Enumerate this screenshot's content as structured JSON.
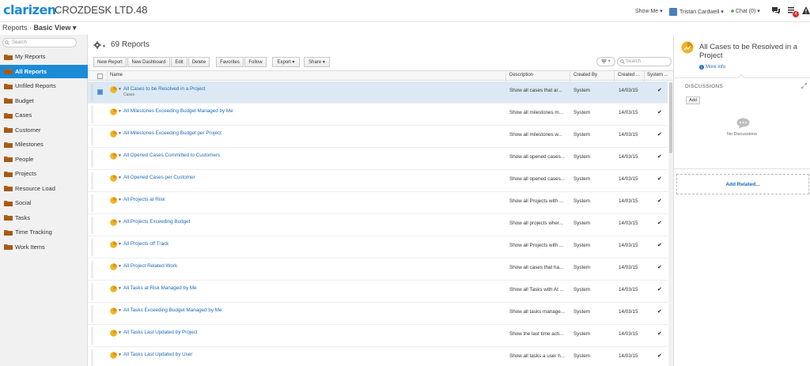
{
  "header": {
    "logo": "clarizen",
    "company": "CROZDESK LTD.48",
    "show_me": "Show Me ▾",
    "user_name": "Tristan Cardwell ▾",
    "chat": "Chat (0) ▾",
    "notification_count": "4"
  },
  "breadcrumb": {
    "section": "Reports · ",
    "view": "Basic View ▾"
  },
  "sidebar": {
    "search_placeholder": "Search",
    "items": [
      {
        "label": "My Reports"
      },
      {
        "label": "All Reports"
      },
      {
        "label": "Unfiled Reports"
      },
      {
        "label": "Budget"
      },
      {
        "label": "Cases"
      },
      {
        "label": "Customer"
      },
      {
        "label": "Milestones"
      },
      {
        "label": "People"
      },
      {
        "label": "Projects"
      },
      {
        "label": "Resource Load"
      },
      {
        "label": "Social"
      },
      {
        "label": "Tasks"
      },
      {
        "label": "Time Tracking"
      },
      {
        "label": "Work Items"
      }
    ],
    "active_index": 1
  },
  "main": {
    "count_label": "69 Reports",
    "toolbar": {
      "new_report": "New Report",
      "new_dashboard": "New Dashboard",
      "edit": "Edit",
      "delete": "Delete",
      "favorites": "Favorites",
      "follow": "Follow",
      "export": "Export ▾",
      "share": "Share ▾",
      "search_placeholder": "Search"
    },
    "columns": {
      "name": "Name",
      "description": "Description",
      "created_by": "Created By",
      "created": "Created ...",
      "system": "System ..."
    },
    "rows": [
      {
        "name": "All Cases to be Resolved in a Project",
        "sub": "Cases",
        "desc": "Show all cases that ar...",
        "by": "System",
        "created": "14/03/15",
        "sys": "✔"
      },
      {
        "name": "All Milestones Exceeding Budget Managed by Me",
        "sub": "",
        "desc": "Show all milestones m...",
        "by": "System",
        "created": "14/03/15",
        "sys": "✔"
      },
      {
        "name": "All Milestones Exceeding Budget per Project",
        "sub": "",
        "desc": "Show all milestones w...",
        "by": "System",
        "created": "14/03/15",
        "sys": "✔"
      },
      {
        "name": "All Opened Cases Committed to Customers",
        "sub": "",
        "desc": "Show all opened cases...",
        "by": "System",
        "created": "14/03/15",
        "sys": "✔"
      },
      {
        "name": "All Opened Cases per Customer",
        "sub": "",
        "desc": "Show all opened cases...",
        "by": "System",
        "created": "14/03/15",
        "sys": "✔"
      },
      {
        "name": "All Projects at Risk",
        "sub": "",
        "desc": "Show all Projects with ...",
        "by": "System",
        "created": "14/03/15",
        "sys": "✔"
      },
      {
        "name": "All Projects Exceeding Budget",
        "sub": "",
        "desc": "Show all projects wher...",
        "by": "System",
        "created": "14/03/15",
        "sys": "✔"
      },
      {
        "name": "All Projects off Track",
        "sub": "",
        "desc": "Show all Projects with ...",
        "by": "System",
        "created": "14/03/15",
        "sys": "✔"
      },
      {
        "name": "All Project Related Work",
        "sub": "",
        "desc": "Show all cases that ha...",
        "by": "System",
        "created": "14/03/15",
        "sys": "✔"
      },
      {
        "name": "All Tasks at Risk Managed by Me",
        "sub": "",
        "desc": "Show all Tasks with At ...",
        "by": "System",
        "created": "14/03/15",
        "sys": "✔"
      },
      {
        "name": "All Tasks Exceeding Budget Managed by Me",
        "sub": "",
        "desc": "Show all tasks manage...",
        "by": "System",
        "created": "14/03/15",
        "sys": "✔"
      },
      {
        "name": "All Tasks Last Updated by Project",
        "sub": "",
        "desc": "Show the last time acti...",
        "by": "System",
        "created": "14/03/15",
        "sys": "✔"
      },
      {
        "name": "All Tasks Last Updated by User",
        "sub": "",
        "desc": "Show all tasks a user h...",
        "by": "System",
        "created": "14/03/15",
        "sys": "✔"
      }
    ]
  },
  "right_panel": {
    "title": "All Cases to be Resolved in a Project",
    "more_info": "More info",
    "discussions_title": "DISCUSSIONS",
    "add_button": "Add",
    "no_discussions": "No Discussions",
    "add_related": "Add Related..."
  },
  "colors": {
    "brand_blue": "#1c8bd6",
    "folder": "#b5651d",
    "report_icon": "#f0b323",
    "link": "#1d6bb8"
  }
}
